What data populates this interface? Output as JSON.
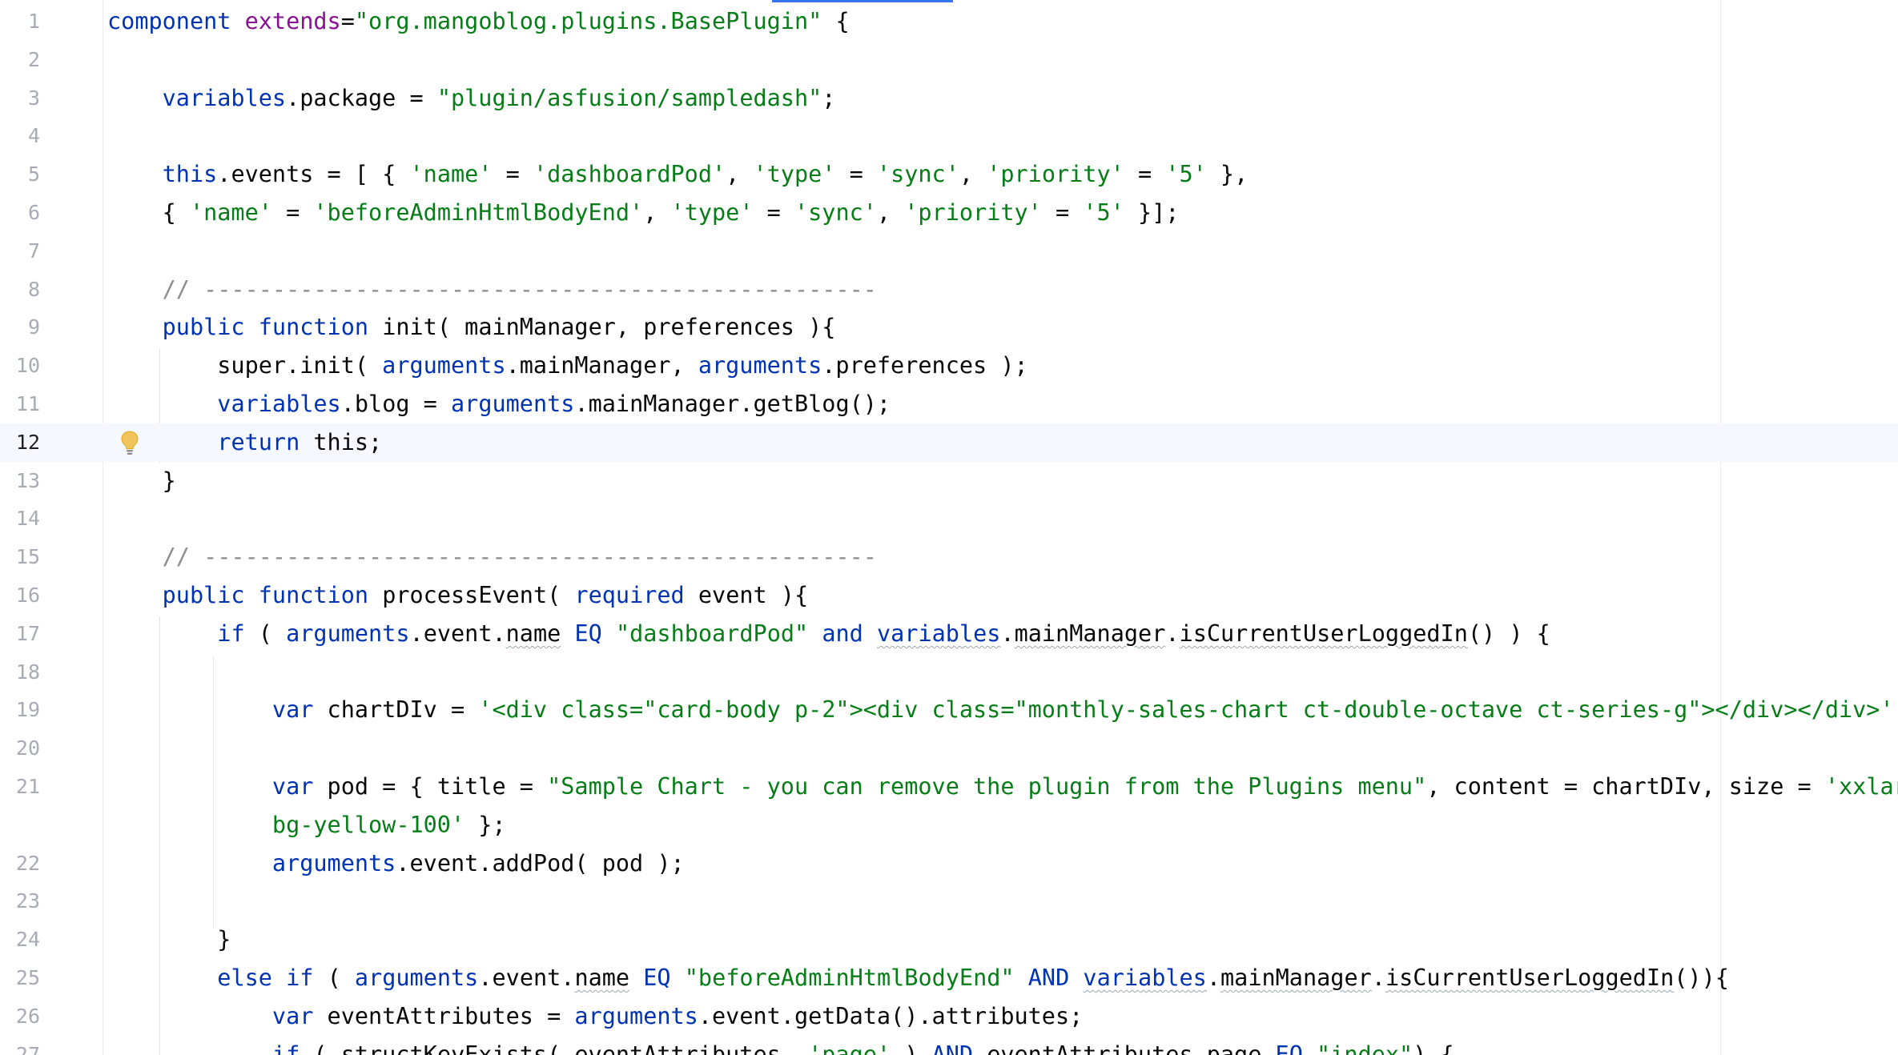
{
  "editor": {
    "current_line": 12,
    "lines": [
      {
        "num": "1",
        "tokens": [
          {
            "t": "component",
            "c": "kw"
          },
          {
            "t": " "
          },
          {
            "t": "extends",
            "c": "att"
          },
          {
            "t": "="
          },
          {
            "t": "\"org.mangoblog.plugins.BasePlugin\"",
            "c": "str"
          },
          {
            "t": " {"
          }
        ]
      },
      {
        "num": "2",
        "tokens": []
      },
      {
        "num": "3",
        "tokens": [
          {
            "t": "    "
          },
          {
            "t": "variables",
            "c": "kw"
          },
          {
            "t": ".package = "
          },
          {
            "t": "\"plugin/asfusion/sampledash\"",
            "c": "str"
          },
          {
            "t": ";"
          }
        ]
      },
      {
        "num": "4",
        "tokens": []
      },
      {
        "num": "5",
        "tokens": [
          {
            "t": "    "
          },
          {
            "t": "this",
            "c": "kw"
          },
          {
            "t": ".events = [ { "
          },
          {
            "t": "'name'",
            "c": "str"
          },
          {
            "t": " = "
          },
          {
            "t": "'dashboardPod'",
            "c": "str"
          },
          {
            "t": ", "
          },
          {
            "t": "'type'",
            "c": "str"
          },
          {
            "t": " = "
          },
          {
            "t": "'sync'",
            "c": "str"
          },
          {
            "t": ", "
          },
          {
            "t": "'priority'",
            "c": "str"
          },
          {
            "t": " = "
          },
          {
            "t": "'5'",
            "c": "str"
          },
          {
            "t": " },"
          }
        ]
      },
      {
        "num": "6",
        "tokens": [
          {
            "t": "    { "
          },
          {
            "t": "'name'",
            "c": "str"
          },
          {
            "t": " = "
          },
          {
            "t": "'beforeAdminHtmlBodyEnd'",
            "c": "str"
          },
          {
            "t": ", "
          },
          {
            "t": "'type'",
            "c": "str"
          },
          {
            "t": " = "
          },
          {
            "t": "'sync'",
            "c": "str"
          },
          {
            "t": ", "
          },
          {
            "t": "'priority'",
            "c": "str"
          },
          {
            "t": " = "
          },
          {
            "t": "'5'",
            "c": "str"
          },
          {
            "t": " }];"
          }
        ]
      },
      {
        "num": "7",
        "tokens": []
      },
      {
        "num": "8",
        "tokens": [
          {
            "t": "    "
          },
          {
            "t": "// -------------------------------------------------",
            "c": "com"
          }
        ]
      },
      {
        "num": "9",
        "tokens": [
          {
            "t": "    "
          },
          {
            "t": "public",
            "c": "kw"
          },
          {
            "t": " "
          },
          {
            "t": "function",
            "c": "kw"
          },
          {
            "t": " init( mainManager, preferences ){"
          }
        ]
      },
      {
        "num": "10",
        "tokens": [
          {
            "t": "        super.init( "
          },
          {
            "t": "arguments",
            "c": "kw"
          },
          {
            "t": ".mainManager, "
          },
          {
            "t": "arguments",
            "c": "kw"
          },
          {
            "t": ".preferences );"
          }
        ]
      },
      {
        "num": "11",
        "tokens": [
          {
            "t": "        "
          },
          {
            "t": "variables",
            "c": "kw"
          },
          {
            "t": ".blog = "
          },
          {
            "t": "arguments",
            "c": "kw"
          },
          {
            "t": ".mainManager.getBlog();"
          }
        ]
      },
      {
        "num": "12",
        "tokens": [
          {
            "t": "        "
          },
          {
            "t": "return",
            "c": "kw"
          },
          {
            "t": " this;"
          }
        ]
      },
      {
        "num": "13",
        "tokens": [
          {
            "t": "    }"
          }
        ]
      },
      {
        "num": "14",
        "tokens": []
      },
      {
        "num": "15",
        "tokens": [
          {
            "t": "    "
          },
          {
            "t": "// -------------------------------------------------",
            "c": "com"
          }
        ]
      },
      {
        "num": "16",
        "tokens": [
          {
            "t": "    "
          },
          {
            "t": "public",
            "c": "kw"
          },
          {
            "t": " "
          },
          {
            "t": "function",
            "c": "kw"
          },
          {
            "t": " processEvent( "
          },
          {
            "t": "required",
            "c": "kw"
          },
          {
            "t": " event ){"
          }
        ]
      },
      {
        "num": "17",
        "tokens": [
          {
            "t": "        "
          },
          {
            "t": "if",
            "c": "kw"
          },
          {
            "t": " ( "
          },
          {
            "t": "arguments",
            "c": "kw"
          },
          {
            "t": ".event."
          },
          {
            "t": "name",
            "c": "typo"
          },
          {
            "t": " "
          },
          {
            "t": "EQ",
            "c": "kw"
          },
          {
            "t": " "
          },
          {
            "t": "\"dashboardPod\"",
            "c": "str"
          },
          {
            "t": " "
          },
          {
            "t": "and",
            "c": "kw"
          },
          {
            "t": " "
          },
          {
            "t": "variables",
            "c": "kwtypo"
          },
          {
            "t": "."
          },
          {
            "t": "mainManager",
            "c": "typo"
          },
          {
            "t": "."
          },
          {
            "t": "isCurrentUserLoggedIn",
            "c": "typo"
          },
          {
            "t": "() ) {"
          }
        ]
      },
      {
        "num": "18",
        "tokens": []
      },
      {
        "num": "19",
        "tokens": [
          {
            "t": "            "
          },
          {
            "t": "var",
            "c": "kw"
          },
          {
            "t": " chartDIv = "
          },
          {
            "t": "'<div class=\"card-body p-2\"><div class=\"monthly-sales-chart ct-double-octave ct-series-g\"></div></div>'",
            "c": "str"
          },
          {
            "t": ";"
          }
        ]
      },
      {
        "num": "20",
        "tokens": []
      },
      {
        "num": "21",
        "tokens": [
          {
            "t": "            "
          },
          {
            "t": "var",
            "c": "kw"
          },
          {
            "t": " pod = { title = "
          },
          {
            "t": "\"Sample Chart - you can remove the plugin from the Plugins menu\"",
            "c": "str"
          },
          {
            "t": ", content = chartDIv, size = "
          },
          {
            "t": "'xxlarge",
            "c": "str"
          }
        ]
      },
      {
        "num": "",
        "tokens": [
          {
            "t": "            "
          },
          {
            "t": "bg-yellow-100'",
            "c": "str"
          },
          {
            "t": " };"
          }
        ]
      },
      {
        "num": "22",
        "tokens": [
          {
            "t": "            "
          },
          {
            "t": "arguments",
            "c": "kw"
          },
          {
            "t": ".event.addPod( pod );"
          }
        ]
      },
      {
        "num": "23",
        "tokens": []
      },
      {
        "num": "24",
        "tokens": [
          {
            "t": "        }"
          }
        ]
      },
      {
        "num": "25",
        "tokens": [
          {
            "t": "        "
          },
          {
            "t": "else",
            "c": "kw"
          },
          {
            "t": " "
          },
          {
            "t": "if",
            "c": "kw"
          },
          {
            "t": " ( "
          },
          {
            "t": "arguments",
            "c": "kw"
          },
          {
            "t": ".event."
          },
          {
            "t": "name",
            "c": "typo"
          },
          {
            "t": " "
          },
          {
            "t": "EQ",
            "c": "kw"
          },
          {
            "t": " "
          },
          {
            "t": "\"beforeAdminHtmlBodyEnd\"",
            "c": "str"
          },
          {
            "t": " "
          },
          {
            "t": "AND",
            "c": "kw"
          },
          {
            "t": " "
          },
          {
            "t": "variables",
            "c": "kwtypo"
          },
          {
            "t": "."
          },
          {
            "t": "mainManager",
            "c": "typo"
          },
          {
            "t": "."
          },
          {
            "t": "isCurrentUserLoggedIn",
            "c": "typo"
          },
          {
            "t": "()){"
          }
        ]
      },
      {
        "num": "26",
        "tokens": [
          {
            "t": "            "
          },
          {
            "t": "var",
            "c": "kw"
          },
          {
            "t": " eventAttributes = "
          },
          {
            "t": "arguments",
            "c": "kw"
          },
          {
            "t": ".event.getData().attributes;"
          }
        ]
      },
      {
        "num": "27",
        "tokens": [
          {
            "t": "            "
          },
          {
            "t": "if",
            "c": "kw"
          },
          {
            "t": " ( structKeyExists( eventAttributes, "
          },
          {
            "t": "'page'",
            "c": "str"
          },
          {
            "t": " ) "
          },
          {
            "t": "AND",
            "c": "kw"
          },
          {
            "t": " eventAttributes.page "
          },
          {
            "t": "EQ",
            "c": "kw"
          },
          {
            "t": " "
          },
          {
            "t": "\"index\"",
            "c": "str"
          },
          {
            "t": ") {"
          }
        ]
      }
    ]
  }
}
